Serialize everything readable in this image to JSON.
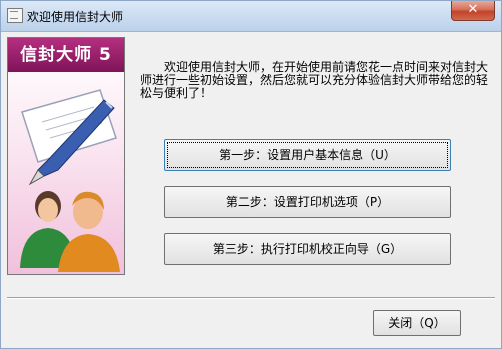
{
  "window": {
    "title": "欢迎使用信封大师",
    "close_glyph": "✕"
  },
  "brand": {
    "banner_text": "信封大师 5"
  },
  "welcome_text": "欢迎使用信封大师，在开始使用前请您花一点时间来对信封大师进行一些初始设置，然后您就可以充分体验信封大师带给您的轻松与便利了！",
  "steps": [
    {
      "label": "第一步：设置用户基本信息（U）"
    },
    {
      "label": "第二步：设置打印机选项（P）"
    },
    {
      "label": "第三步：执行打印机校正向导（G）"
    }
  ],
  "close_button": {
    "label": "关闭（Q）"
  },
  "colors": {
    "banner": "#9a1f6c",
    "titlebar": "#c7daf0",
    "close": "#c1432b"
  },
  "icons": [
    "app-icon",
    "close-icon",
    "envelope-pen-illustration",
    "users-illustration"
  ]
}
